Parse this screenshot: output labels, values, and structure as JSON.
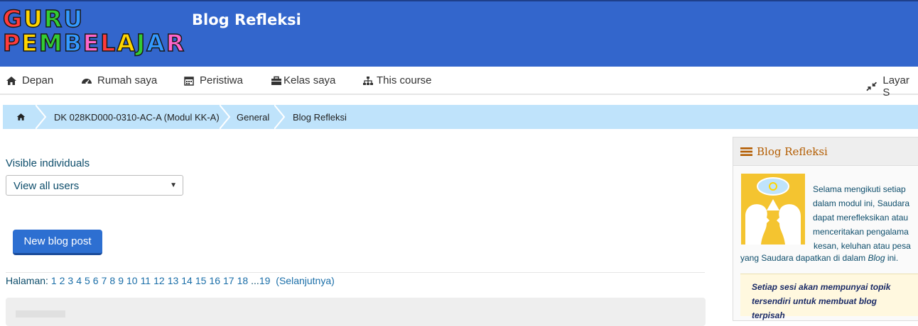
{
  "header": {
    "logo_line1": "GURU",
    "logo_line2": "PEMBELAJAR",
    "site_title": "Blog Refleksi",
    "bg_color": "#3366cc"
  },
  "nav": {
    "items": [
      {
        "label": "Depan",
        "icon": "home-icon"
      },
      {
        "label": "Rumah saya",
        "icon": "dashboard-icon"
      },
      {
        "label": "Peristiwa",
        "icon": "calendar-icon"
      },
      {
        "label": "Kelas saya",
        "icon": "briefcase-icon"
      },
      {
        "label": "This course",
        "icon": "sitemap-icon"
      }
    ],
    "fullscreen_label": "Layar S",
    "fullscreen_icon": "compress-icon"
  },
  "breadcrumb": {
    "home_icon": "home-icon",
    "items": [
      "DK 028KD000-0310-AC-A (Modul KK-A)",
      "General",
      "Blog Refleksi"
    ]
  },
  "main": {
    "visible_label": "Visible individuals",
    "select_value": "View all users",
    "new_post_label": "New blog post",
    "paging_prefix": "Halaman:",
    "pages": [
      "1",
      "2",
      "3",
      "4",
      "5",
      "6",
      "7",
      "8",
      "9",
      "10",
      "11",
      "12",
      "13",
      "14",
      "15",
      "16",
      "17",
      "18"
    ],
    "ellipsis": "...",
    "last_page": "19",
    "next_label": "(Selanjutnya)"
  },
  "sidebar": {
    "block_title": "Blog Refleksi",
    "menu_icon": "bars-icon",
    "image_icon": "reflection-heads-icon",
    "text_lines": [
      "Selama mengikuti setiap",
      "dalam modul ini, Saudara",
      "dapat merefleksikan atau",
      "menceritakan pengalama",
      "kesan, keluhan atau pesa"
    ],
    "text_tail_before": "yang Saudara dapatkan di dalam ",
    "text_tail_em": "Blog",
    "text_tail_after": " ini.",
    "note_line1": "Setiap sesi akan mempunyai topik",
    "note_line2": "tersendiri untuk membuat blog",
    "note_line3": "terpisah"
  }
}
